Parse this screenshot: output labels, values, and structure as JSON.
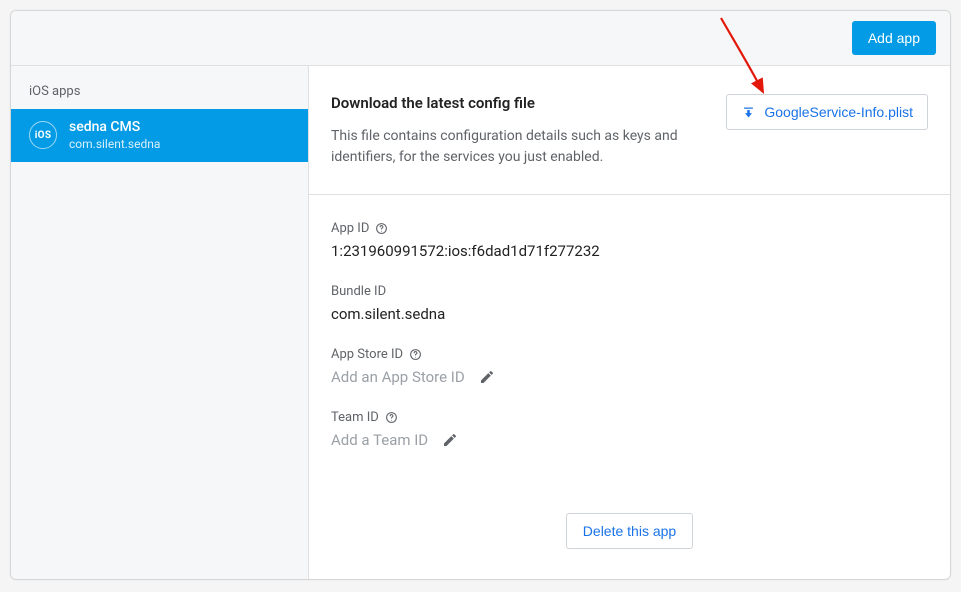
{
  "header": {
    "add_app_label": "Add app"
  },
  "sidebar": {
    "section_label": "iOS apps",
    "apps": [
      {
        "icon_text": "iOS",
        "name": "sedna CMS",
        "bundle": "com.silent.sedna"
      }
    ]
  },
  "config": {
    "title": "Download the latest config file",
    "description": "This file contains configuration details such as keys and identifiers, for the services you just enabled.",
    "download_label": "GoogleService-Info.plist"
  },
  "details": {
    "app_id": {
      "label": "App ID",
      "value": "1:231960991572:ios:f6dad1d71f277232"
    },
    "bundle_id": {
      "label": "Bundle ID",
      "value": "com.silent.sedna"
    },
    "app_store_id": {
      "label": "App Store ID",
      "placeholder": "Add an App Store ID"
    },
    "team_id": {
      "label": "Team ID",
      "placeholder": "Add a Team ID"
    }
  },
  "actions": {
    "delete_label": "Delete this app"
  }
}
